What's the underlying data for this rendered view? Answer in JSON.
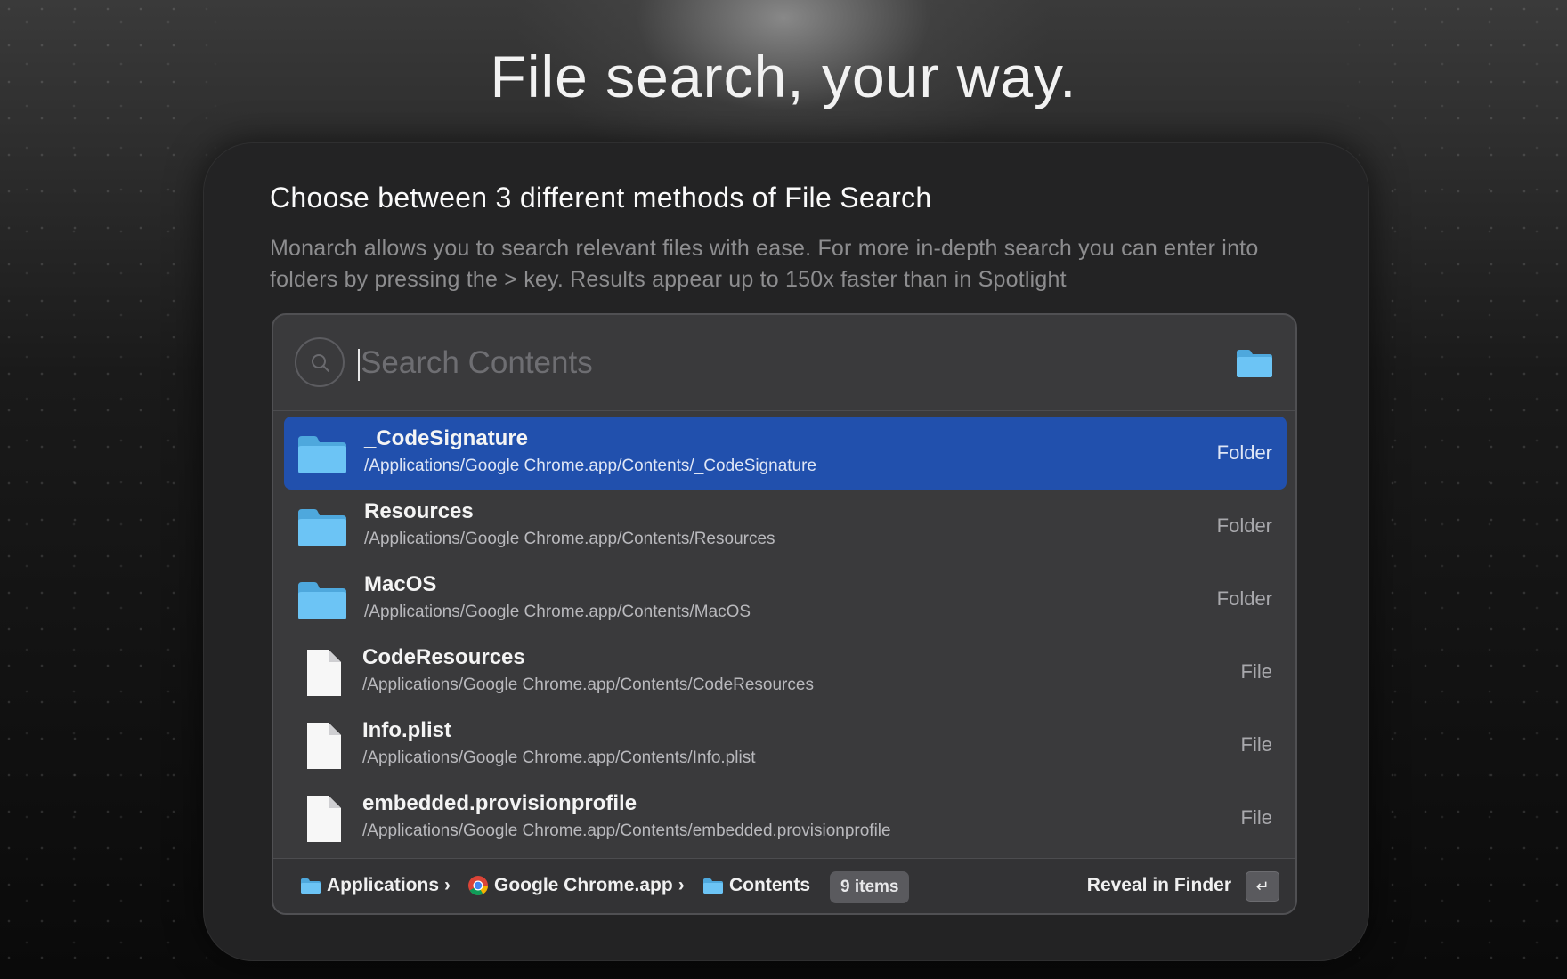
{
  "page": {
    "title": "File search, your way."
  },
  "card": {
    "heading": "Choose between 3 different methods of File Search",
    "description": "Monarch allows you to search relevant files with ease. For more in-depth search you can enter into folders by pressing the > key. Results appear up to 150x faster than in Spotlight"
  },
  "search": {
    "placeholder": "Search Contents",
    "value": "",
    "left_icon": "search-icon",
    "right_icon": "folder-icon"
  },
  "results": [
    {
      "name": "_CodeSignature",
      "path": "/Applications/Google Chrome.app/Contents/_CodeSignature",
      "kind": "Folder",
      "icon": "folder-icon",
      "selected": true
    },
    {
      "name": "Resources",
      "path": "/Applications/Google Chrome.app/Contents/Resources",
      "kind": "Folder",
      "icon": "folder-icon",
      "selected": false
    },
    {
      "name": "MacOS",
      "path": "/Applications/Google Chrome.app/Contents/MacOS",
      "kind": "Folder",
      "icon": "folder-icon",
      "selected": false
    },
    {
      "name": "CodeResources",
      "path": "/Applications/Google Chrome.app/Contents/CodeResources",
      "kind": "File",
      "icon": "file-icon",
      "selected": false
    },
    {
      "name": "Info.plist",
      "path": "/Applications/Google Chrome.app/Contents/Info.plist",
      "kind": "File",
      "icon": "file-icon",
      "selected": false
    },
    {
      "name": "embedded.provisionprofile",
      "path": "/Applications/Google Chrome.app/Contents/embedded.provisionprofile",
      "kind": "File",
      "icon": "file-icon",
      "selected": false
    }
  ],
  "footer": {
    "breadcrumb": [
      {
        "label": "Applications",
        "icon": "folder-icon",
        "separator": "›"
      },
      {
        "label": "Google Chrome.app",
        "icon": "chrome-icon",
        "separator": "›"
      },
      {
        "label": "Contents",
        "icon": "folder-icon",
        "separator": ""
      }
    ],
    "count_badge": "9 items",
    "action_label": "Reveal in Finder",
    "action_key": "↵"
  },
  "colors": {
    "selection": "#2150ad",
    "folder": "#6cc4f5",
    "window_bg": "#3a3a3c",
    "card_bg": "#232324"
  }
}
